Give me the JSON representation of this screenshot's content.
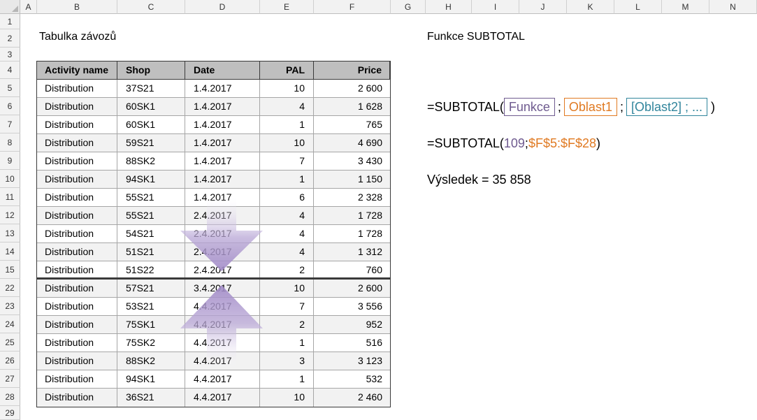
{
  "columns": [
    "A",
    "B",
    "C",
    "D",
    "E",
    "F",
    "G",
    "H",
    "I",
    "J",
    "K",
    "L",
    "M",
    "N"
  ],
  "rows": [
    "1",
    "2",
    "3",
    "4",
    "5",
    "6",
    "7",
    "8",
    "9",
    "10",
    "11",
    "12",
    "13",
    "14",
    "15",
    "22",
    "23",
    "24",
    "25",
    "26",
    "27",
    "28",
    "29"
  ],
  "left_title": "Tabulka závozů",
  "right_title": "Funkce SUBTOTAL",
  "table": {
    "headers": [
      "Activity name",
      "Shop",
      "Date",
      "PAL",
      "Price"
    ],
    "rows": [
      [
        "Distribution",
        "37S21",
        "1.4.2017",
        "10",
        "2 600"
      ],
      [
        "Distribution",
        "60SK1",
        "1.4.2017",
        "4",
        "1 628"
      ],
      [
        "Distribution",
        "60SK1",
        "1.4.2017",
        "1",
        "765"
      ],
      [
        "Distribution",
        "59S21",
        "1.4.2017",
        "10",
        "4 690"
      ],
      [
        "Distribution",
        "88SK2",
        "1.4.2017",
        "7",
        "3 430"
      ],
      [
        "Distribution",
        "94SK1",
        "1.4.2017",
        "1",
        "1 150"
      ],
      [
        "Distribution",
        "55S21",
        "1.4.2017",
        "6",
        "2 328"
      ],
      [
        "Distribution",
        "55S21",
        "2.4.2017",
        "4",
        "1 728"
      ],
      [
        "Distribution",
        "54S21",
        "2.4.2017",
        "4",
        "1 728"
      ],
      [
        "Distribution",
        "51S21",
        "2.4.2017",
        "4",
        "1 312"
      ],
      [
        "Distribution",
        "51S22",
        "2.4.2017",
        "2",
        "760"
      ],
      [
        "Distribution",
        "57S21",
        "3.4.2017",
        "10",
        "2 600"
      ],
      [
        "Distribution",
        "53S21",
        "4.4.2017",
        "7",
        "3 556"
      ],
      [
        "Distribution",
        "75SK1",
        "4.4.2017",
        "2",
        "952"
      ],
      [
        "Distribution",
        "75SK2",
        "4.4.2017",
        "1",
        "516"
      ],
      [
        "Distribution",
        "88SK2",
        "4.4.2017",
        "3",
        "3 123"
      ],
      [
        "Distribution",
        "94SK1",
        "4.4.2017",
        "1",
        "532"
      ],
      [
        "Distribution",
        "36S21",
        "4.4.2017",
        "10",
        "2 460"
      ]
    ]
  },
  "syntax": {
    "prefix": "=SUBTOTAL(",
    "arg1": "Funkce",
    "sep": ";",
    "arg2": "Oblast1",
    "arg3": "[Oblast2]  ;  ...",
    "suffix": ")"
  },
  "example": {
    "prefix": "=SUBTOTAL(",
    "func_num": "109",
    "sep": ";",
    "range": "$F$5:$F$28",
    "suffix": ")"
  },
  "result": "Výsledek = 35 858",
  "colors": {
    "funkce": "#6f5b8f",
    "oblast1": "#e07a22",
    "oblast2": "#31859c",
    "arrow": "#b9a7d6"
  },
  "icons": [
    "arrow-down-icon",
    "arrow-up-icon",
    "select-all-icon"
  ]
}
